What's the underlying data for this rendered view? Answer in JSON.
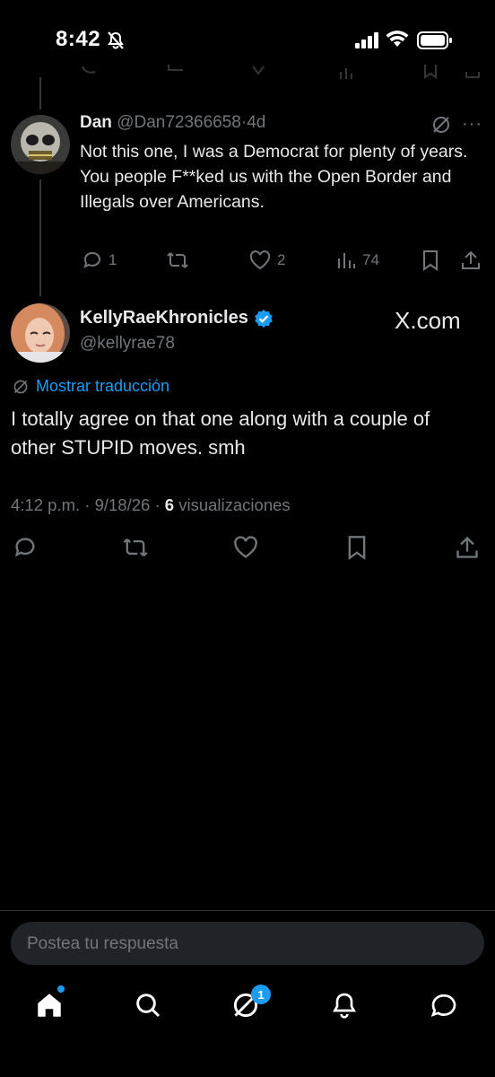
{
  "status_bar": {
    "time": "8:42"
  },
  "reply_tweet": {
    "author_name": "Dan",
    "author_handle": "@Dan72366658",
    "time_ago": "4d",
    "text_line1": "Not this one, I was a Democrat for plenty of years.",
    "text_line2": "You people F**ked us with the Open Border and Illegals over Americans.",
    "replies": "1",
    "likes": "2",
    "views": "74"
  },
  "main_tweet": {
    "author_name": "KellyRaeKhronicles",
    "author_handle": "@kellyrae78",
    "watermark": "X.com",
    "translate_label": "Mostrar traducción",
    "text": "I totally agree on that one along with a couple of other STUPID moves. smh",
    "time": "4:12 p.m.",
    "date": "9/18/26",
    "views_count": "6",
    "views_label": "visualizaciones"
  },
  "reply_input": {
    "placeholder": "Postea tu respuesta"
  },
  "bottom_nav": {
    "grok_badge": "1"
  },
  "colors": {
    "accent": "#1d9bf0",
    "muted": "#71767b",
    "text": "#e7e9ea",
    "background": "#000000"
  },
  "icons": [
    "bell-off-icon",
    "signal-icon",
    "wifi-icon",
    "battery-icon",
    "grok-icon",
    "more-icon",
    "reply-icon",
    "retweet-icon",
    "like-icon",
    "views-icon",
    "bookmark-icon",
    "share-icon",
    "verified-icon",
    "home-icon",
    "search-icon",
    "notifications-icon",
    "messages-icon"
  ]
}
